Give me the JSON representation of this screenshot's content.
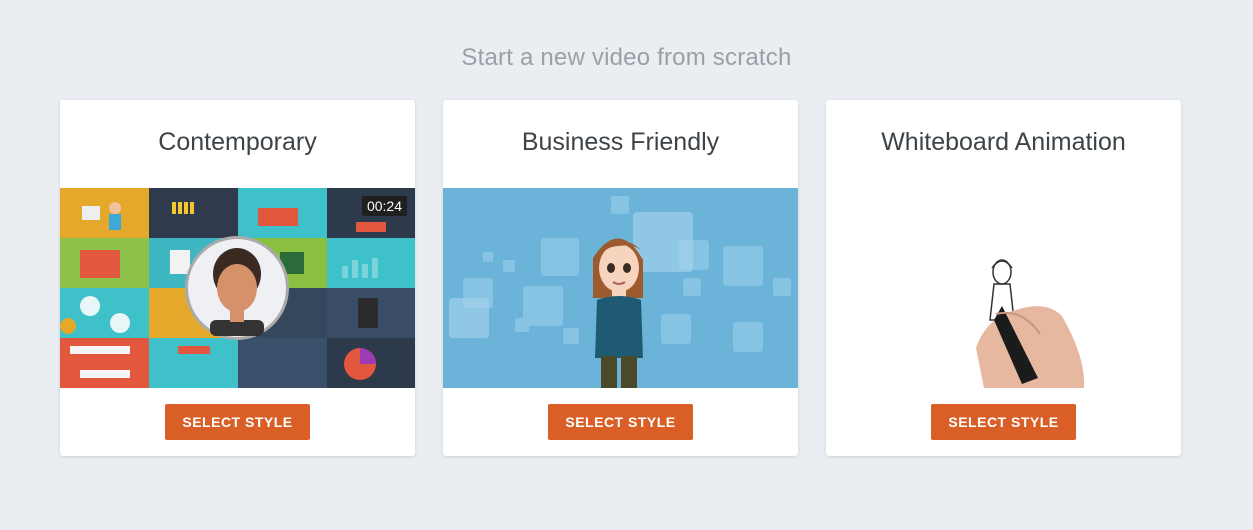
{
  "page": {
    "heading": "Start a new video from scratch"
  },
  "cards": [
    {
      "title": "Contemporary",
      "button_label": "SELECT STYLE",
      "timer": "00:24"
    },
    {
      "title": "Business Friendly",
      "button_label": "SELECT STYLE"
    },
    {
      "title": "Whiteboard Animation",
      "button_label": "SELECT STYLE"
    }
  ],
  "colors": {
    "background": "#eaedf1",
    "button": "#d95f27",
    "business_bg": "#6bb3d9"
  }
}
